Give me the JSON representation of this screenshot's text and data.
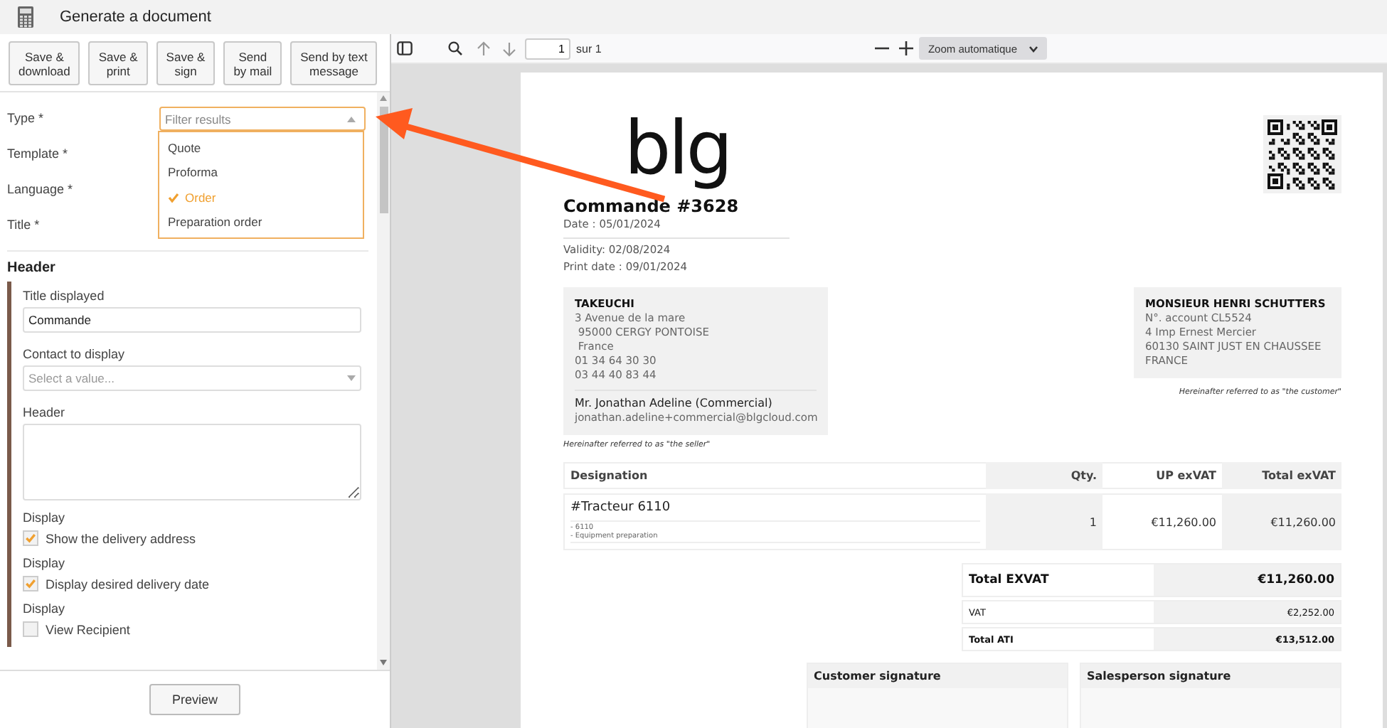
{
  "window": {
    "title": "Generate a document"
  },
  "actions": [
    "Save &\ndownload",
    "Save &\nprint",
    "Save &\nsign",
    "Send\nby mail",
    "Send by text\nmessage"
  ],
  "form": {
    "fields": [
      {
        "label": "Type *"
      },
      {
        "label": "Template *"
      },
      {
        "label": "Language *"
      },
      {
        "label": "Title *"
      }
    ],
    "type_dropdown": {
      "placeholder": "Filter results",
      "options": [
        {
          "label": "Quote",
          "selected": false
        },
        {
          "label": "Proforma",
          "selected": false
        },
        {
          "label": "Order",
          "selected": true
        },
        {
          "label": "Preparation order",
          "selected": false
        }
      ]
    }
  },
  "section": {
    "title": "Header",
    "items": [
      {
        "kind": "text",
        "label": "Title displayed",
        "value": "Commande"
      },
      {
        "kind": "select",
        "label": "Contact to display",
        "placeholder": "Select a value..."
      },
      {
        "kind": "textarea",
        "label": "Header"
      },
      {
        "kind": "checkbox",
        "label": "Display",
        "option": "Show the delivery address",
        "checked": true
      },
      {
        "kind": "checkbox",
        "label": "Display",
        "option": "Display desired delivery date",
        "checked": true
      },
      {
        "kind": "checkbox",
        "label": "Display",
        "option": "View Recipient",
        "checked": false
      }
    ]
  },
  "footer": {
    "button": "Preview"
  },
  "viewer": {
    "page": "1",
    "page_count": "sur 1",
    "zoom": "Zoom automatique"
  },
  "document": {
    "logo": "blg",
    "title": "Commande #3628",
    "dates": [
      "Date : 05/01/2024",
      "Validity: 02/08/2024",
      "Print date : 09/01/2024"
    ],
    "seller": {
      "name": "TAKEUCHI",
      "lines": [
        "3 Avenue de la mare",
        " 95000 CERGY PONTOISE",
        " France",
        "01 34 64 30 30",
        "03 44 40 83 44"
      ],
      "contact_name": "Mr. Jonathan Adeline (Commercial)",
      "contact_email": "jonathan.adeline+commercial@blgcloud.com",
      "caption": "Hereinafter referred to as \"the seller\""
    },
    "customer": {
      "name": "MONSIEUR HENRI SCHUTTERS",
      "lines": [
        "N°. account CL5524",
        "4 Imp Ernest Mercier",
        "60130 SAINT JUST EN CHAUSSEE",
        "FRANCE"
      ],
      "caption": "Hereinafter referred to as \"the customer\""
    },
    "table": {
      "columns": [
        "Designation",
        "Qty.",
        "UP exVAT",
        "Total exVAT"
      ],
      "rows": [
        {
          "designation": "#Tracteur 6110",
          "details": [
            "- 6110",
            "- Equipment preparation"
          ],
          "qty": "1",
          "unit_price": "€11,260.00",
          "total": "€11,260.00"
        }
      ]
    },
    "totals": [
      {
        "kind": "main",
        "label": "Total EXVAT",
        "value": "€11,260.00"
      },
      {
        "kind": "minor",
        "label": "VAT",
        "value": "€2,252.00"
      },
      {
        "kind": "grand",
        "label": "Total ATI",
        "value": "€13,512.00"
      }
    ],
    "signatures": [
      "Customer signature",
      "Salesperson signature"
    ]
  }
}
